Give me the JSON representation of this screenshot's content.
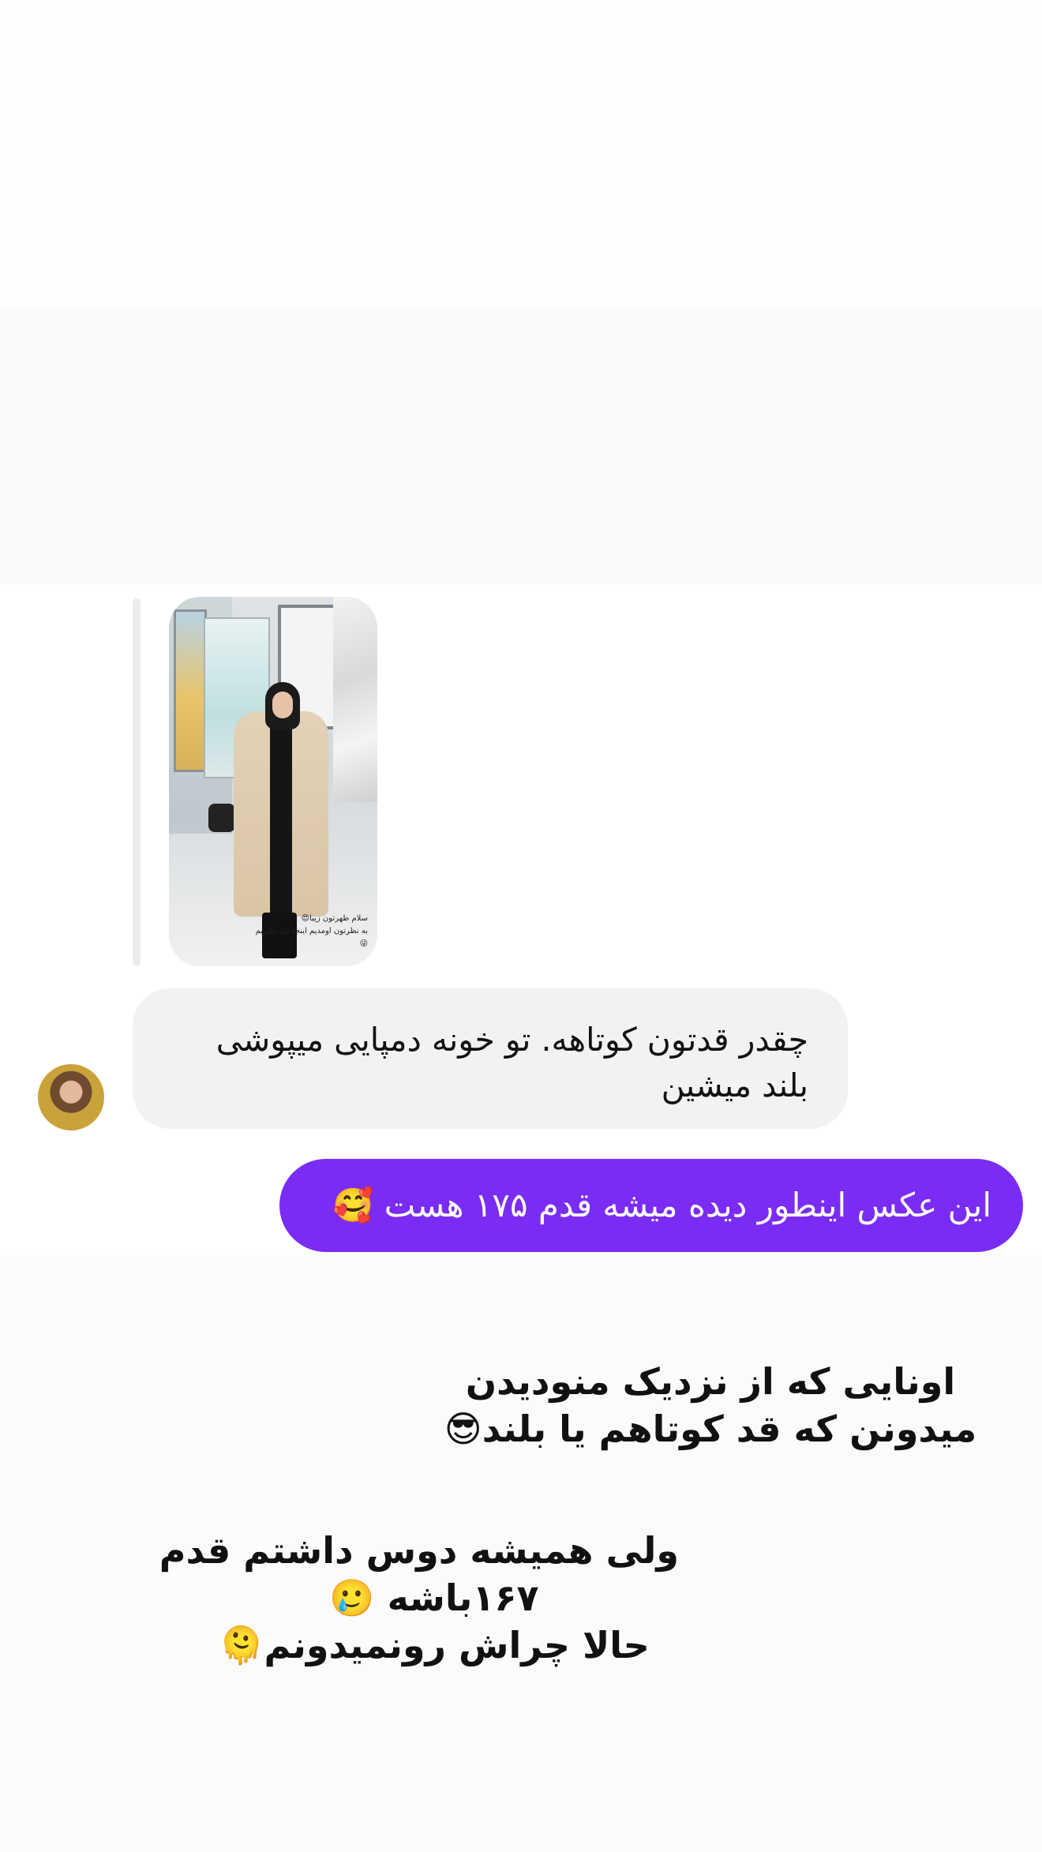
{
  "reply_image": {
    "caption_line_1": "سلام ظهرتون زیبا😍",
    "caption_line_2": "به نظرتون اومدیم اینجا چی بگیریم😜"
  },
  "incoming_message": {
    "text": "چقدر قدتون کوتاهه. تو خونه دمپایی میپوشی بلند میشین"
  },
  "outgoing_message": {
    "text": "این عکس اینطور دیده میشه قدم ۱۷۵ هست 🥰"
  },
  "story_text_1": {
    "line_1": "اونایی که از نزدیک منودیدن",
    "line_2": "میدونن که قد کوتاهم یا بلند😎"
  },
  "story_text_2": {
    "line_1": "ولی همیشه دوس داشتم قدم",
    "line_2": "۱۶۷باشه 🥲",
    "line_3": "حالا چراش رونمیدونم🫠"
  }
}
